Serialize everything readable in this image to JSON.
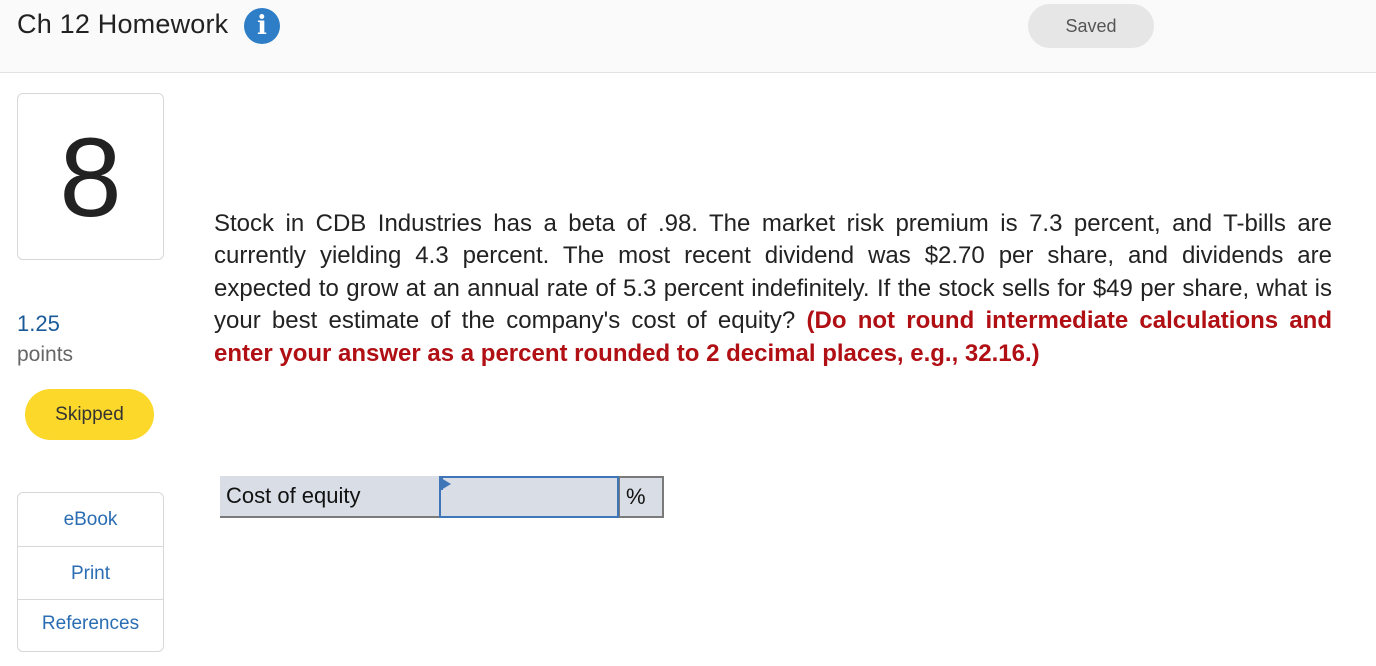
{
  "header": {
    "title": "Ch 12 Homework",
    "info_icon_glyph": "i",
    "saved_label": "Saved"
  },
  "question": {
    "number": "8",
    "points_value": "1.25",
    "points_label": "points",
    "status": "Skipped",
    "text": "Stock in CDB Industries has a beta of .98. The market risk premium is 7.3 percent, and T-bills are currently yielding 4.3 percent. The most recent dividend was $2.70 per share, and dividends are expected to grow at an annual rate of 5.3 percent indefinitely. If the stock sells for $49 per share, what is your best estimate of the company's cost of equity?",
    "instructions": "(Do not round intermediate calculations and enter your answer as a percent rounded to 2 decimal places, e.g., 32.16.)"
  },
  "side_links": {
    "ebook": "eBook",
    "print": "Print",
    "references": "References"
  },
  "answer": {
    "label": "Cost of equity",
    "value": "",
    "unit": "%"
  },
  "colors": {
    "accent_blue": "#2d7ec7",
    "link_blue": "#2a6db3",
    "instruction_red": "#b00f14",
    "skipped_yellow": "#fcd82b",
    "input_bg": "#d9dde6"
  },
  "icons": [
    "info-icon",
    "flag-icon"
  ]
}
